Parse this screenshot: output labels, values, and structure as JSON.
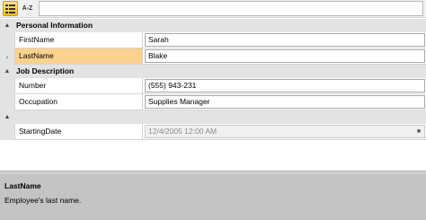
{
  "toolbar": {
    "categorized_label": "",
    "alphabetical_label": "A-Z",
    "search_value": ""
  },
  "categories": [
    {
      "title": "Personal Information",
      "properties": [
        {
          "name": "FirstName",
          "value": "Sarah",
          "selected": false,
          "readonly": false
        },
        {
          "name": "LastName",
          "value": "Blake",
          "selected": true,
          "readonly": false
        }
      ]
    },
    {
      "title": "Job Description",
      "properties": [
        {
          "name": "Number",
          "value": "(555) 943-231",
          "selected": false,
          "readonly": false
        },
        {
          "name": "Occupation",
          "value": "Supplies Manager",
          "selected": false,
          "readonly": false
        }
      ]
    },
    {
      "title": "",
      "properties": [
        {
          "name": "StartingDate",
          "value": "12/4/2005 12:00 AM",
          "selected": false,
          "readonly": true
        }
      ]
    }
  ],
  "description": {
    "title": "LastName",
    "text": "Employee's last name."
  },
  "icons": {
    "collapse": "chevron-up-icon",
    "selected_row": "chevron-right-icon",
    "categorized": "categorized-view-icon",
    "picker": "dropdown-icon"
  },
  "colors": {
    "selected_row": "#fbd18e",
    "category_bg": "#e3e3e3",
    "description_bg": "#c4c4c4",
    "active_button": "#fbbf24"
  }
}
